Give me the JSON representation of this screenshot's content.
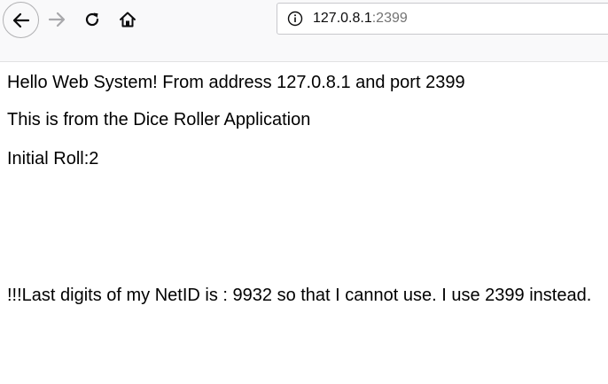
{
  "browser": {
    "url_host": "127.0.8.1",
    "url_port": ":2399",
    "icons": {
      "back": "back-arrow-icon",
      "forward": "forward-arrow-icon",
      "reload": "reload-icon",
      "home": "home-icon",
      "info": "info-icon"
    }
  },
  "page": {
    "greeting": "Hello Web System! From address 127.0.8.1 and port 2399",
    "app_line": "This is from the Dice Roller Application",
    "roll_line": "Initial Roll:2",
    "note_line": "!!!Last digits of my NetID is : 9932 so that I cannot use. I use 2399 instead."
  }
}
